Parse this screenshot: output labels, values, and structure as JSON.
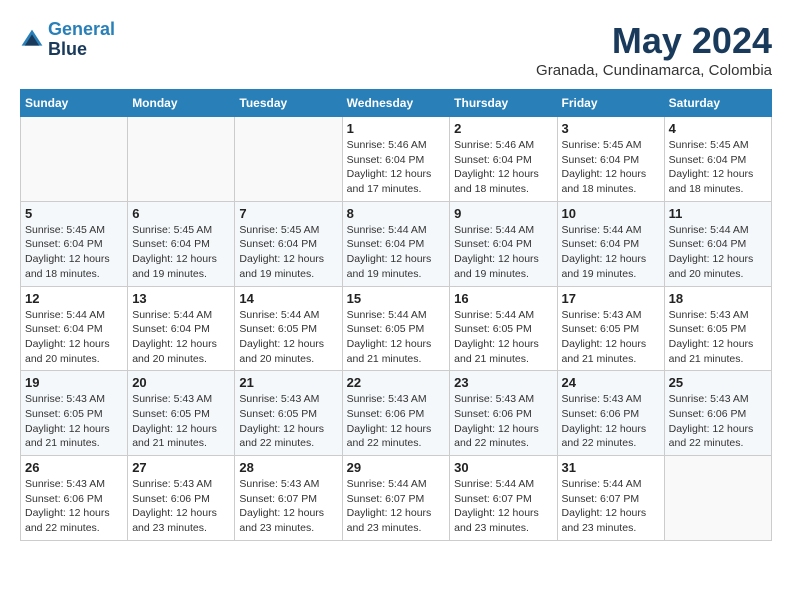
{
  "header": {
    "logo_line1": "General",
    "logo_line2": "Blue",
    "month": "May 2024",
    "location": "Granada, Cundinamarca, Colombia"
  },
  "days_of_week": [
    "Sunday",
    "Monday",
    "Tuesday",
    "Wednesday",
    "Thursday",
    "Friday",
    "Saturday"
  ],
  "weeks": [
    [
      {
        "day": "",
        "info": ""
      },
      {
        "day": "",
        "info": ""
      },
      {
        "day": "",
        "info": ""
      },
      {
        "day": "1",
        "info": "Sunrise: 5:46 AM\nSunset: 6:04 PM\nDaylight: 12 hours\nand 17 minutes."
      },
      {
        "day": "2",
        "info": "Sunrise: 5:46 AM\nSunset: 6:04 PM\nDaylight: 12 hours\nand 18 minutes."
      },
      {
        "day": "3",
        "info": "Sunrise: 5:45 AM\nSunset: 6:04 PM\nDaylight: 12 hours\nand 18 minutes."
      },
      {
        "day": "4",
        "info": "Sunrise: 5:45 AM\nSunset: 6:04 PM\nDaylight: 12 hours\nand 18 minutes."
      }
    ],
    [
      {
        "day": "5",
        "info": "Sunrise: 5:45 AM\nSunset: 6:04 PM\nDaylight: 12 hours\nand 18 minutes."
      },
      {
        "day": "6",
        "info": "Sunrise: 5:45 AM\nSunset: 6:04 PM\nDaylight: 12 hours\nand 19 minutes."
      },
      {
        "day": "7",
        "info": "Sunrise: 5:45 AM\nSunset: 6:04 PM\nDaylight: 12 hours\nand 19 minutes."
      },
      {
        "day": "8",
        "info": "Sunrise: 5:44 AM\nSunset: 6:04 PM\nDaylight: 12 hours\nand 19 minutes."
      },
      {
        "day": "9",
        "info": "Sunrise: 5:44 AM\nSunset: 6:04 PM\nDaylight: 12 hours\nand 19 minutes."
      },
      {
        "day": "10",
        "info": "Sunrise: 5:44 AM\nSunset: 6:04 PM\nDaylight: 12 hours\nand 19 minutes."
      },
      {
        "day": "11",
        "info": "Sunrise: 5:44 AM\nSunset: 6:04 PM\nDaylight: 12 hours\nand 20 minutes."
      }
    ],
    [
      {
        "day": "12",
        "info": "Sunrise: 5:44 AM\nSunset: 6:04 PM\nDaylight: 12 hours\nand 20 minutes."
      },
      {
        "day": "13",
        "info": "Sunrise: 5:44 AM\nSunset: 6:04 PM\nDaylight: 12 hours\nand 20 minutes."
      },
      {
        "day": "14",
        "info": "Sunrise: 5:44 AM\nSunset: 6:05 PM\nDaylight: 12 hours\nand 20 minutes."
      },
      {
        "day": "15",
        "info": "Sunrise: 5:44 AM\nSunset: 6:05 PM\nDaylight: 12 hours\nand 21 minutes."
      },
      {
        "day": "16",
        "info": "Sunrise: 5:44 AM\nSunset: 6:05 PM\nDaylight: 12 hours\nand 21 minutes."
      },
      {
        "day": "17",
        "info": "Sunrise: 5:43 AM\nSunset: 6:05 PM\nDaylight: 12 hours\nand 21 minutes."
      },
      {
        "day": "18",
        "info": "Sunrise: 5:43 AM\nSunset: 6:05 PM\nDaylight: 12 hours\nand 21 minutes."
      }
    ],
    [
      {
        "day": "19",
        "info": "Sunrise: 5:43 AM\nSunset: 6:05 PM\nDaylight: 12 hours\nand 21 minutes."
      },
      {
        "day": "20",
        "info": "Sunrise: 5:43 AM\nSunset: 6:05 PM\nDaylight: 12 hours\nand 21 minutes."
      },
      {
        "day": "21",
        "info": "Sunrise: 5:43 AM\nSunset: 6:05 PM\nDaylight: 12 hours\nand 22 minutes."
      },
      {
        "day": "22",
        "info": "Sunrise: 5:43 AM\nSunset: 6:06 PM\nDaylight: 12 hours\nand 22 minutes."
      },
      {
        "day": "23",
        "info": "Sunrise: 5:43 AM\nSunset: 6:06 PM\nDaylight: 12 hours\nand 22 minutes."
      },
      {
        "day": "24",
        "info": "Sunrise: 5:43 AM\nSunset: 6:06 PM\nDaylight: 12 hours\nand 22 minutes."
      },
      {
        "day": "25",
        "info": "Sunrise: 5:43 AM\nSunset: 6:06 PM\nDaylight: 12 hours\nand 22 minutes."
      }
    ],
    [
      {
        "day": "26",
        "info": "Sunrise: 5:43 AM\nSunset: 6:06 PM\nDaylight: 12 hours\nand 22 minutes."
      },
      {
        "day": "27",
        "info": "Sunrise: 5:43 AM\nSunset: 6:06 PM\nDaylight: 12 hours\nand 23 minutes."
      },
      {
        "day": "28",
        "info": "Sunrise: 5:43 AM\nSunset: 6:07 PM\nDaylight: 12 hours\nand 23 minutes."
      },
      {
        "day": "29",
        "info": "Sunrise: 5:44 AM\nSunset: 6:07 PM\nDaylight: 12 hours\nand 23 minutes."
      },
      {
        "day": "30",
        "info": "Sunrise: 5:44 AM\nSunset: 6:07 PM\nDaylight: 12 hours\nand 23 minutes."
      },
      {
        "day": "31",
        "info": "Sunrise: 5:44 AM\nSunset: 6:07 PM\nDaylight: 12 hours\nand 23 minutes."
      },
      {
        "day": "",
        "info": ""
      }
    ]
  ]
}
